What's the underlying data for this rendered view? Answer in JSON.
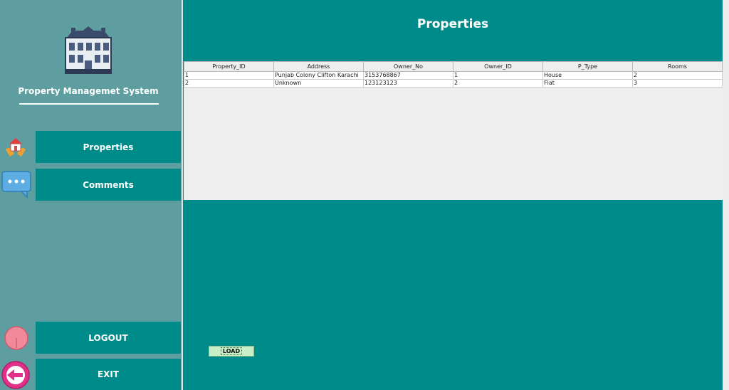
{
  "sidebar": {
    "app_title": "Property Managemet System",
    "logo_icon": "building-icon",
    "nav": [
      {
        "label": "Properties",
        "icon": "home-in-hands-icon"
      },
      {
        "label": "Comments",
        "icon": "speech-bubble-icon"
      },
      {
        "label": "LOGOUT",
        "icon": "logout-circle-icon"
      },
      {
        "label": "EXIT",
        "icon": "exit-arrow-icon"
      }
    ]
  },
  "main": {
    "title": "Properties",
    "table": {
      "columns": [
        "Property_ID",
        "Address",
        "Owner_No",
        "Owner_ID",
        "P_Type",
        "Rooms"
      ],
      "rows": [
        [
          "1",
          "Punjab Colony Clifton Karachi",
          "3153768867",
          "1",
          "House",
          "2"
        ],
        [
          "2",
          "Unknown",
          "123123123",
          "2",
          "Flat",
          "3"
        ]
      ]
    },
    "load_label": "LOAD"
  },
  "colors": {
    "sidebar_bg": "#5f9ea0",
    "accent": "#008b8b",
    "load_button": "#c8f0c8"
  }
}
